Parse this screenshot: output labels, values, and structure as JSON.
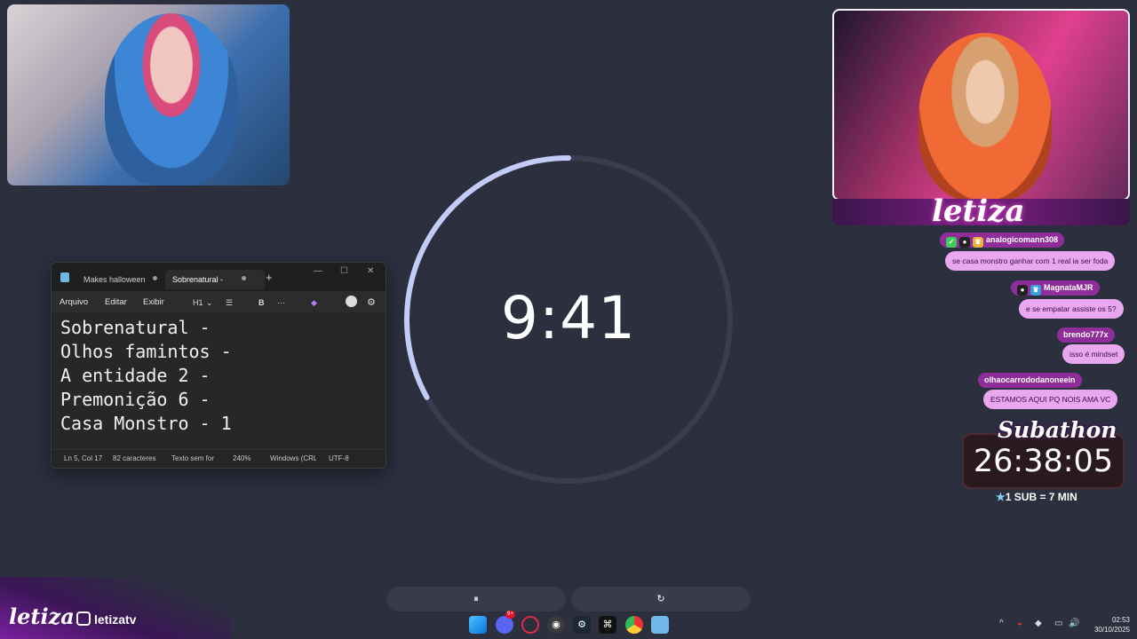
{
  "webcams": {
    "left": {
      "label": ""
    },
    "right": {
      "brand": "letiza"
    }
  },
  "notepad": {
    "tabs": [
      "Makes halloween",
      "Sobrenatural -"
    ],
    "new_tab": "+",
    "window_controls": {
      "minimize": "—",
      "maximize": "☐",
      "close": "✕"
    },
    "menu": [
      "Arquivo",
      "Editar",
      "Exibir"
    ],
    "toolbar": {
      "heading": "H1",
      "list": "☰",
      "bold": "B",
      "more": "···",
      "settings": "⚙"
    },
    "lines": "Sobrenatural -\nOlhos famintos -\nA entidade 2 -\nPremonição 6 -\nCasa Monstro - 1",
    "status": {
      "position": "Ln 5, Col 17",
      "chars": "82 caracteres",
      "format": "Texto sem for",
      "zoom": "240%",
      "eol": "Windows (CRL",
      "encoding": "UTF-8"
    }
  },
  "timer": {
    "time": "9:41",
    "progress": 0.33,
    "pause_icon": "⏸",
    "reset_icon": "↻",
    "colors": {
      "track": "#393d4e",
      "arc": "#c3cbf7"
    }
  },
  "chat": [
    {
      "user": "analogicomann308",
      "message": "se casa monstro ganhar com 1 real ia ser foda"
    },
    {
      "user": "MagnataMJR",
      "message": "e se empatar assiste os 5?"
    },
    {
      "user": "brendo777x",
      "message": "isso é mindset"
    },
    {
      "user": "olhaocarrododanoneein",
      "message": "ESTAMOS AQUI PQ NOIS AMA VC"
    }
  ],
  "subathon": {
    "title": "Subathon",
    "time": "26:38:05",
    "rate": "1 SUB = 7 MIN"
  },
  "footer": {
    "logo": "letiza",
    "social": "letizatv"
  },
  "taskbar": {
    "badge": "9+",
    "clock_time": "02:53",
    "clock_date": "30/10/2025"
  }
}
